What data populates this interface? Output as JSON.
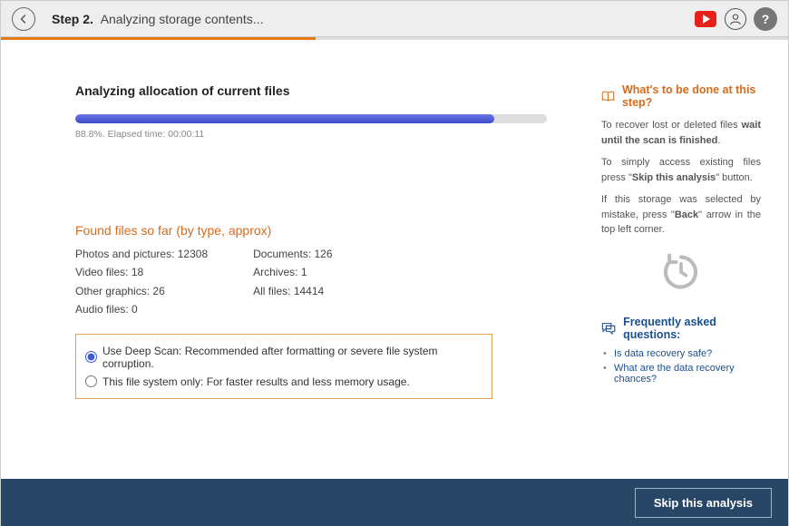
{
  "header": {
    "step_bold": "Step 2.",
    "step_text": "Analyzing storage contents..."
  },
  "progress": {
    "title": "Analyzing allocation of current files",
    "percent": 88.8,
    "percent_text": "88.8%",
    "elapsed_label": "Elapsed time:",
    "elapsed": "00:00:11"
  },
  "found": {
    "title": "Found files so far (by type, approx)",
    "col1": {
      "photos_label": "Photos and pictures:",
      "photos": "12308",
      "video_label": "Video files:",
      "video": "18",
      "other_label": "Other graphics:",
      "other": "26",
      "audio_label": "Audio files:",
      "audio": "0"
    },
    "col2": {
      "docs_label": "Documents:",
      "docs": "126",
      "arch_label": "Archives:",
      "arch": "1",
      "all_label": "All files:",
      "all": "14414"
    }
  },
  "scan_options": {
    "deep": "Use Deep Scan: Recommended after formatting or severe file system corruption.",
    "fs_only": "This file system only: For faster results and less memory usage."
  },
  "help": {
    "title": "What's to be done at this step?",
    "p1a": "To recover lost or deleted files ",
    "p1b": "wait until the scan is finished",
    "p1c": ".",
    "p2a": "To simply access existing files press \"",
    "p2b": "Skip this analysis",
    "p2c": "\" button.",
    "p3a": "If this storage was selected by mistake, press \"",
    "p3b": "Back",
    "p3c": "\" arrow in the top left corner."
  },
  "faq": {
    "title": "Frequently asked questions:",
    "q1": "Is data recovery safe?",
    "q2": "What are the data recovery chances?"
  },
  "footer": {
    "skip": "Skip this analysis"
  }
}
